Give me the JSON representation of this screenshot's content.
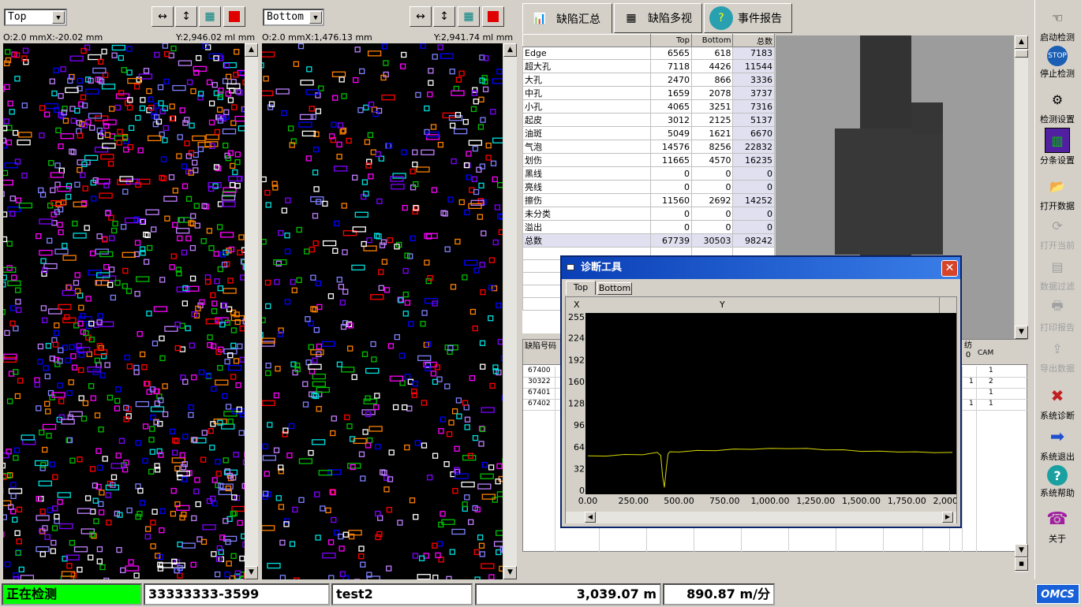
{
  "left_panel": {
    "combo": "Top",
    "coord_left": "O:2.0 mmX:-20.02 mm",
    "coord_right": "Y:2,946.02 ml mm"
  },
  "mid_panel": {
    "combo": "Bottom",
    "coord_left": "O:2.0 mmX:1,476.13 mm",
    "coord_right": "Y:2,941.74 ml mm"
  },
  "tabs": [
    {
      "label": "缺陷汇总",
      "icon": "summary-icon"
    },
    {
      "label": "缺陷多视",
      "icon": "multiview-icon"
    },
    {
      "label": "事件报告",
      "icon": "help-question-icon"
    }
  ],
  "summary": {
    "headers": [
      "",
      "Top",
      "Bottom",
      "总数"
    ],
    "rows": [
      [
        "Edge",
        "6565",
        "618",
        "7183"
      ],
      [
        "超大孔",
        "7118",
        "4426",
        "11544"
      ],
      [
        "大孔",
        "2470",
        "866",
        "3336"
      ],
      [
        "中孔",
        "1659",
        "2078",
        "3737"
      ],
      [
        "小孔",
        "4065",
        "3251",
        "7316"
      ],
      [
        "起皮",
        "3012",
        "2125",
        "5137"
      ],
      [
        "油斑",
        "5049",
        "1621",
        "6670"
      ],
      [
        "气泡",
        "14576",
        "8256",
        "22832"
      ],
      [
        "划伤",
        "11665",
        "4570",
        "16235"
      ],
      [
        "黑线",
        "0",
        "0",
        "0"
      ],
      [
        "亮线",
        "0",
        "0",
        "0"
      ],
      [
        "擦伤",
        "11560",
        "2692",
        "14252"
      ],
      [
        "未分类",
        "0",
        "0",
        "0"
      ],
      [
        "溢出",
        "0",
        "0",
        "0"
      ],
      [
        "总数",
        "67739",
        "30503",
        "98242"
      ]
    ]
  },
  "defect_list": {
    "header_left": "缺陷号码",
    "header_mid": "",
    "header_r1": "纺0",
    "header_r2": "CAM",
    "rows": [
      [
        "67400",
        "",
        "1"
      ],
      [
        "30322",
        "1",
        "2"
      ],
      [
        "67401",
        "",
        "1"
      ],
      [
        "67402",
        "1",
        "1"
      ]
    ]
  },
  "diag": {
    "title": "诊断工具",
    "tabs": [
      "Top",
      "Bottom"
    ],
    "col_x": "X",
    "col_y": "Y",
    "chart_data": {
      "type": "line",
      "xlabel": "",
      "ylabel": "",
      "xlim": [
        0,
        2000
      ],
      "ylim": [
        0,
        255
      ],
      "yticks": [
        "255",
        "224",
        "192",
        "160",
        "128",
        "96",
        "64",
        "32",
        "0"
      ],
      "xticks": [
        "0.00",
        "250.00",
        "500.00",
        "750.00",
        "1,000.00",
        "1,250.00",
        "1,500.00",
        "1,750.00",
        "2,000.00"
      ],
      "series": [
        {
          "color": "#d8d800",
          "x": [
            0,
            100,
            200,
            300,
            380,
            400,
            410,
            420,
            430,
            440,
            450,
            500,
            600,
            700,
            800,
            900,
            1000,
            1100,
            1200,
            1300,
            1400,
            1500,
            1600,
            1700,
            1800,
            1900,
            2000
          ],
          "y": [
            50,
            51,
            52,
            53,
            55,
            52,
            20,
            5,
            30,
            54,
            56,
            57,
            58,
            59,
            60,
            61,
            61,
            62,
            61,
            60,
            59,
            58,
            57,
            57,
            56,
            56,
            55
          ]
        }
      ]
    }
  },
  "toolbar_right": [
    {
      "label": "启动检测",
      "icon": "hand-pointer-icon",
      "enabled": true
    },
    {
      "label": "停止检测",
      "icon": "stop-sign-icon",
      "enabled": true
    },
    {
      "label": "检测设置",
      "icon": "gear-icon",
      "enabled": true
    },
    {
      "label": "分条设置",
      "icon": "split-icon",
      "enabled": true
    },
    {
      "label": "打开数据",
      "icon": "folder-open-icon",
      "enabled": true
    },
    {
      "label": "打开当前",
      "icon": "refresh-icon",
      "enabled": false
    },
    {
      "label": "数据过滤",
      "icon": "filter-icon",
      "enabled": false
    },
    {
      "label": "打印报告",
      "icon": "print-icon",
      "enabled": false
    },
    {
      "label": "导出数据",
      "icon": "export-icon",
      "enabled": false
    },
    {
      "label": "系统诊断",
      "icon": "tools-icon",
      "enabled": true
    },
    {
      "label": "系统退出",
      "icon": "exit-arrow-icon",
      "enabled": true
    },
    {
      "label": "系统帮助",
      "icon": "help-icon",
      "enabled": true
    },
    {
      "label": "关于",
      "icon": "phone-icon",
      "enabled": true
    }
  ],
  "status": {
    "state": "正在检测",
    "job": "33333333-3599",
    "name": "test2",
    "length": "3,039.07 m",
    "speed": "890.87 m/分",
    "logo": "OMCS"
  },
  "colors": {
    "status_green": "#00ff00",
    "title_blue": "#0a246a"
  }
}
